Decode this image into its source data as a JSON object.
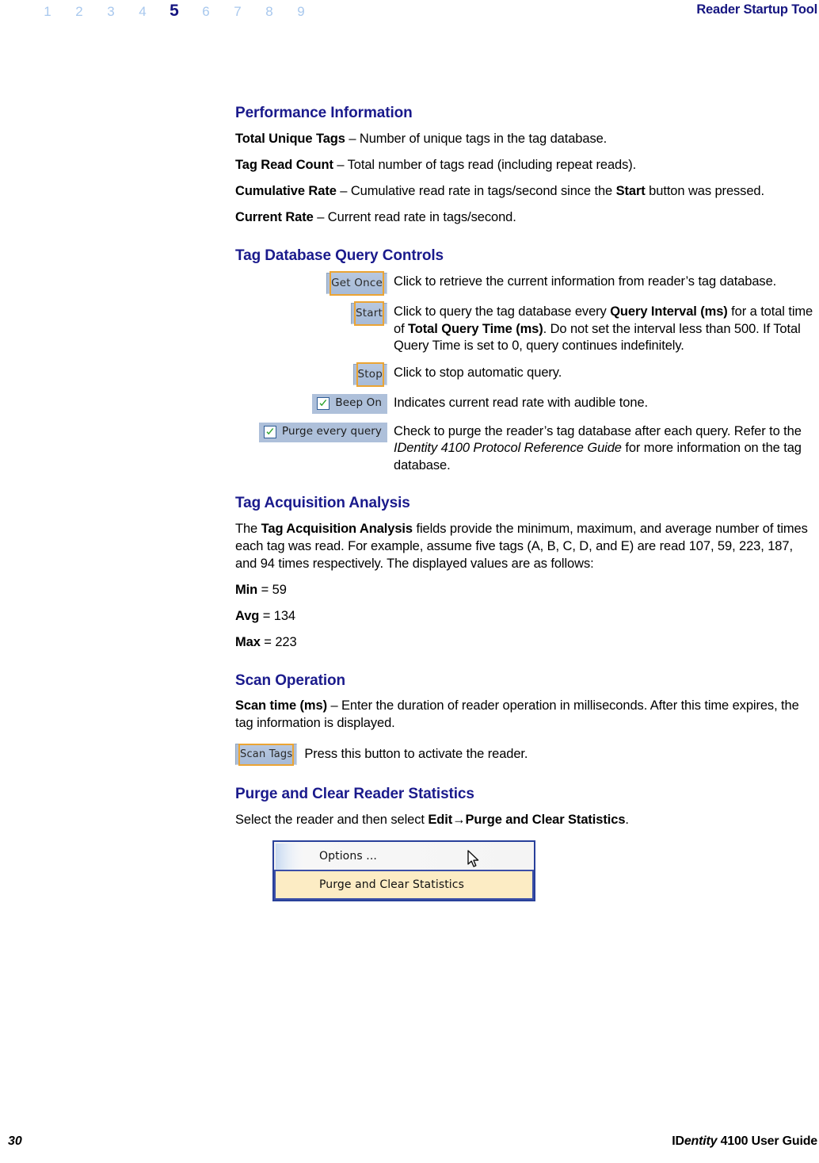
{
  "header": {
    "chapter_numbers": [
      "1",
      "2",
      "3",
      "4",
      "5",
      "6",
      "7",
      "8",
      "9"
    ],
    "current_chapter": "5",
    "title": "Reader Startup Tool"
  },
  "sections": {
    "performance": {
      "heading": "Performance Information",
      "items": [
        {
          "term": "Total Unique Tags",
          "dash": " – ",
          "desc": "Number of unique tags in the tag database."
        },
        {
          "term": "Tag Read Count",
          "dash": " – ",
          "desc": "Total number of tags read (including repeat reads)."
        },
        {
          "term": "Cumulative Rate",
          "dash": " – ",
          "desc_a": "Cumulative read rate in tags/second since the ",
          "bold_b": "Start",
          "desc_c": " button was pressed."
        },
        {
          "term": "Current Rate",
          "dash": " – ",
          "desc": "Current read rate in tags/second."
        }
      ]
    },
    "query_controls": {
      "heading": "Tag Database Query Controls",
      "rows": [
        {
          "control_type": "button",
          "label": "Get Once",
          "desc": "Click to retrieve the current information from reader’s tag database."
        },
        {
          "control_type": "button",
          "label": "Start",
          "desc_a": "Click to query the tag database every ",
          "bold_b": "Query Interval (ms)",
          "desc_c": " for a total time of ",
          "bold_d": "Total Query Time (ms)",
          "desc_e": ". Do not set the interval less than 500. If Total Query Time is set to 0, query continues indefinitely."
        },
        {
          "control_type": "button",
          "label": "Stop",
          "desc": "Click to stop automatic query."
        },
        {
          "control_type": "checkbox",
          "label": "Beep On",
          "checked": true,
          "desc": "Indicates current read rate with audible tone."
        },
        {
          "control_type": "checkbox",
          "label": "Purge every query",
          "checked": true,
          "desc_a": "Check to purge the reader’s tag database after each query. Refer to the ",
          "italic_b": "IDentity 4100 Protocol Reference Guide",
          "desc_c": " for more information on the tag database."
        }
      ]
    },
    "acquisition": {
      "heading": "Tag Acquisition Analysis",
      "paragraph_a": "The ",
      "paragraph_bold": "Tag Acquisition Analysis",
      "paragraph_c": " fields provide the minimum, maximum, and average number of times each tag was read. For example, assume five tags (A, B, C, D, and E) are read 107, 59, 223, 187, and 94 times respectively. The displayed values are as follows:",
      "values": [
        {
          "label": "Min",
          "equals": " = ",
          "value": "59"
        },
        {
          "label": "Avg",
          "equals": " = ",
          "value": "134"
        },
        {
          "label": "Max",
          "equals": " = ",
          "value": "223"
        }
      ]
    },
    "scan": {
      "heading": "Scan Operation",
      "term": "Scan time (ms)",
      "dash": " – ",
      "desc": "Enter the duration of reader operation in milliseconds. After this time expires, the tag information is displayed.",
      "button_label": "Scan Tags",
      "button_desc": "Press this button to activate the reader."
    },
    "purge": {
      "heading": "Purge and Clear Reader Statistics",
      "desc_a": "Select the reader and then select ",
      "bold_b": "Edit→Purge and Clear Statistics",
      "desc_c": ".",
      "menu": {
        "items": [
          {
            "label": "Options ...",
            "highlighted": false
          },
          {
            "label": "Purge and Clear Statistics",
            "highlighted": true
          }
        ],
        "cursor": "mouse-pointer-icon"
      }
    }
  },
  "footer": {
    "page_number": "30",
    "guide_prefix": "ID",
    "guide_italic": "entity",
    "guide_suffix": " 4100 User Guide"
  },
  "colors": {
    "heading_navy": "#1a1a8c",
    "header_inactive": "#a8c8ee",
    "header_active": "#151580",
    "button_border_gold": "#eba434",
    "button_fill": "#aec0da",
    "menu_highlight": "#fcecc4",
    "menu_border": "#28409a",
    "check_green": "#2cа12c"
  }
}
